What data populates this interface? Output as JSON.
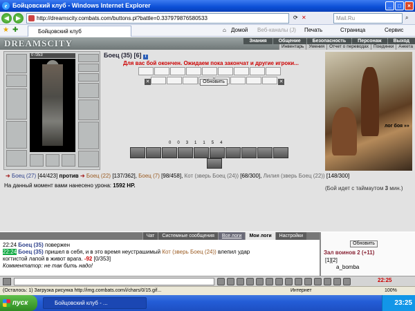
{
  "window": {
    "title": "Бойцовский клуб - Windows Internet Explorer"
  },
  "address": {
    "url": "http://dreamscity.combats.com/buttons.pl?battle=0.337979876580533",
    "search_placeholder": "Mail.Ru"
  },
  "toolbar": {
    "home": "Домой",
    "feeds": "Веб-каналы (J)",
    "print": "Печать",
    "page": "Страница",
    "service": "Сервис"
  },
  "tab": {
    "label": "Бойцовский клуб"
  },
  "game": {
    "logo": "DREAMSCITY",
    "menu": [
      "Знания",
      "Общение",
      "Безопасность",
      "Персонаж",
      "Выход"
    ],
    "submenu": [
      "Инвентарь",
      "Умения",
      "Отчет о переводах",
      "Поединки",
      "Анкета"
    ],
    "hp_display": "0 /353",
    "hp_fraction": 0,
    "fighter_name": "Боец",
    "fighter_level": "(35) [6]",
    "notice": "Для вас бой окончен. Ожидаем пока закончат и другие игроки...",
    "refresh_label": "Обновить",
    "art_caption": "лог боя »»",
    "stats": [
      "0",
      "0",
      "3",
      "1",
      "1",
      "5",
      "4"
    ],
    "versus": {
      "left_name": "Боец",
      "left_level": "(27)",
      "left_hp": "[44/423]",
      "vs_word": "против",
      "right1_name": "Боец",
      "right1_level": "(22)",
      "right1_hp": "[137/362]",
      "right2_name": "Боец",
      "right2_level": "(7)",
      "right2_hp": "[98/458]",
      "right3": "Кот (зверь Боец (24))",
      "right3_hp": "[68/300]",
      "right4": "Лилия (зверь Боец (22))",
      "right4_hp": "[148/300]"
    },
    "damage_text": "На данный момент вами нанесено урона:",
    "damage_value": "1592 HP.",
    "timeout_text": "(Бой идет с таймаутом",
    "timeout_value": "3",
    "timeout_unit": "мин.)"
  },
  "chat": {
    "tabs": [
      "Чат",
      "Системные сообщения",
      "Все логи",
      "Мои логи",
      "Настройки"
    ],
    "lines": [
      {
        "time": "22:24",
        "name": "Боец",
        "level": "(35)",
        "text": "повержен"
      },
      {
        "time": "22:24",
        "name": "Боец",
        "level": "(35)",
        "text": "пришел в себя, и в это время неустрашимый",
        "attacker": "Кот (зверь Боец (24))",
        "text2": "влепил удар"
      },
      {
        "text": "когтистой лапой в живот врага.",
        "damage": "-92",
        "hp": "[0/353]"
      },
      {
        "comment": "Комментатор: не так бить надо!"
      }
    ]
  },
  "side": {
    "refresh_label": "Обновить",
    "hall": "Зал воинов 2 (+11)",
    "pages": "[1][2]",
    "user": "a_bomba"
  },
  "clock": "22:25",
  "status": {
    "text": "(Осталось: 1) Загрузка рисунка http://img.combats.com/i/chars/0/15.gif...",
    "zone": "Интернет",
    "zoom": "100%"
  },
  "taskbar": {
    "start": "пуск",
    "item": "Бойцовский клуб - ...",
    "time": "23:25"
  }
}
